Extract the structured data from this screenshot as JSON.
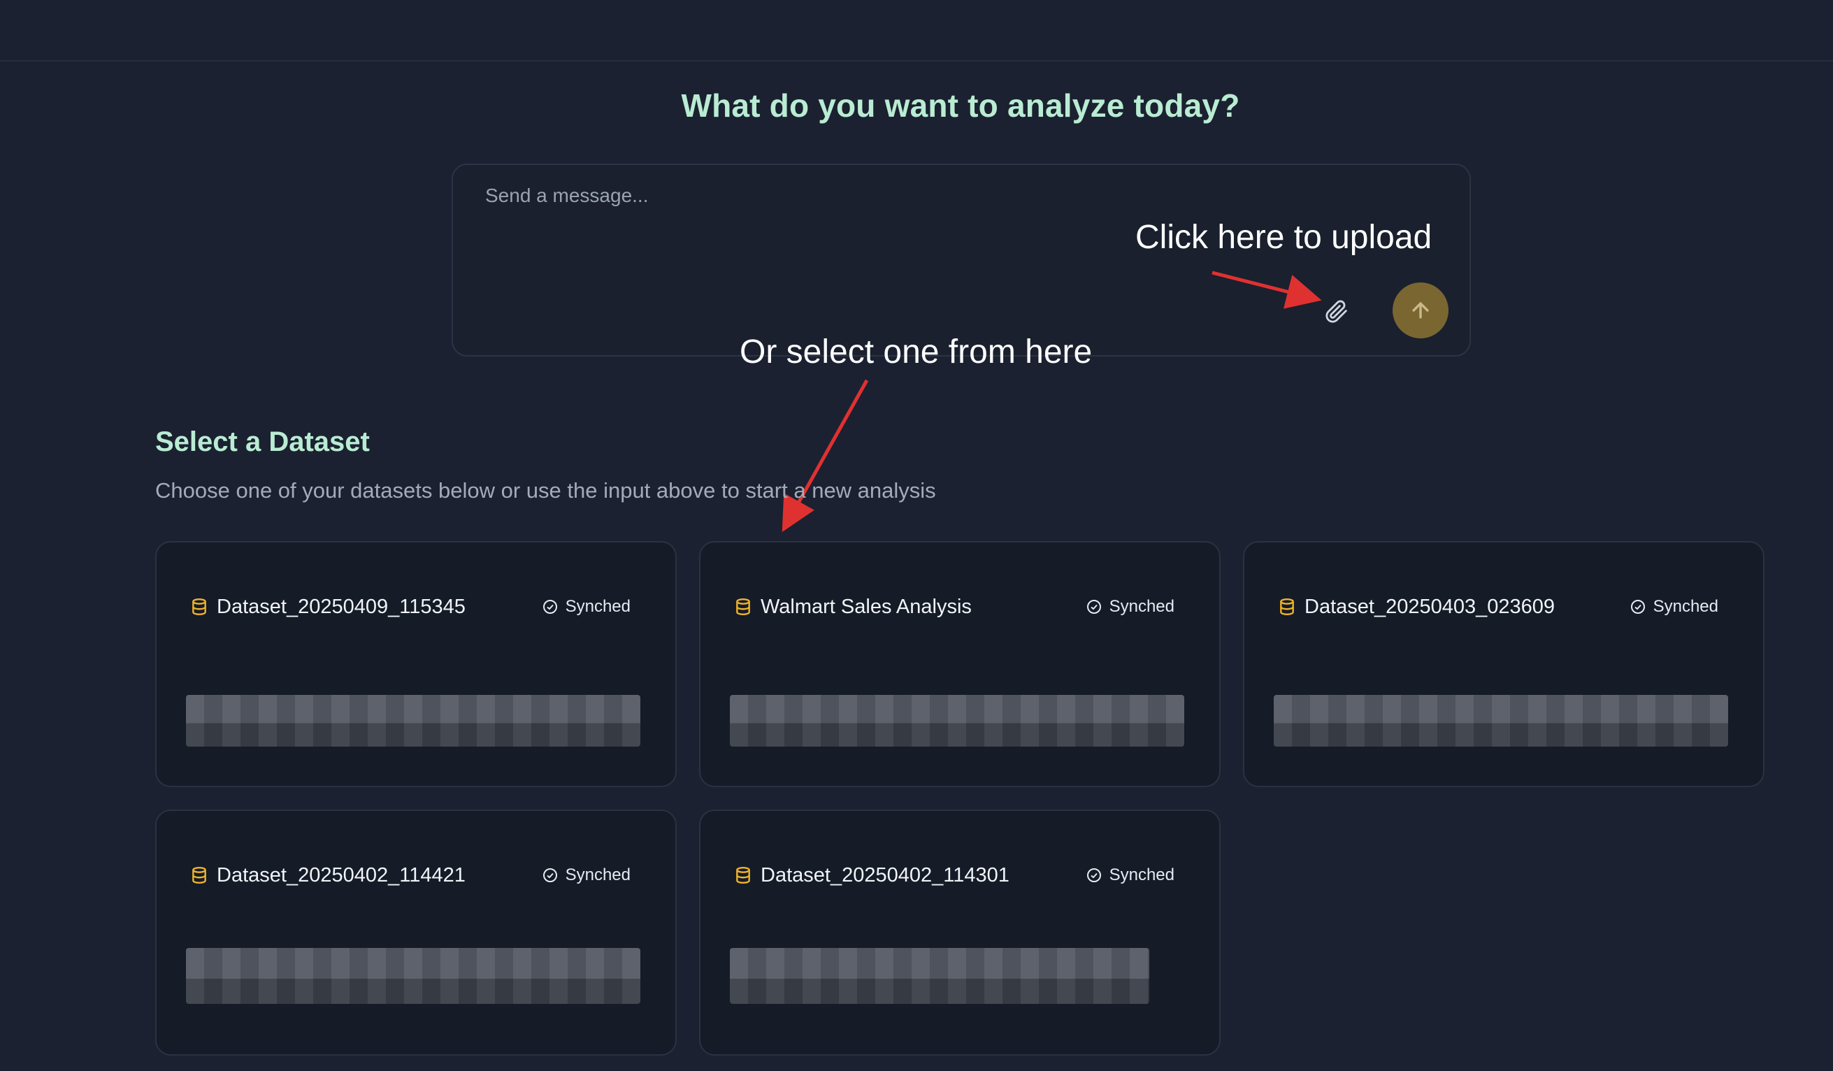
{
  "page": {
    "headline": "What do you want to analyze today?"
  },
  "composer": {
    "placeholder": "Send a message...",
    "attach_icon": "paperclip-icon",
    "send_icon": "arrow-up-icon"
  },
  "annotations": {
    "upload": "Click here to upload",
    "select": "Or select one from here"
  },
  "section": {
    "title": "Select a Dataset",
    "subtitle": "Choose one of your datasets below or use the input above to start a new analysis"
  },
  "datasets": [
    {
      "name": "Dataset_20250409_115345",
      "status": "Synched"
    },
    {
      "name": "Walmart Sales Analysis",
      "status": "Synched"
    },
    {
      "name": "Dataset_20250403_023609",
      "status": "Synched"
    },
    {
      "name": "Dataset_20250402_114421",
      "status": "Synched"
    },
    {
      "name": "Dataset_20250402_114301",
      "status": "Synched"
    }
  ],
  "colors": {
    "background": "#1b2130",
    "accent_text": "#b9ecd3",
    "send_button": "#7a6631",
    "dataset_icon": "#f0b429",
    "annotation_arrow": "#e03131"
  }
}
